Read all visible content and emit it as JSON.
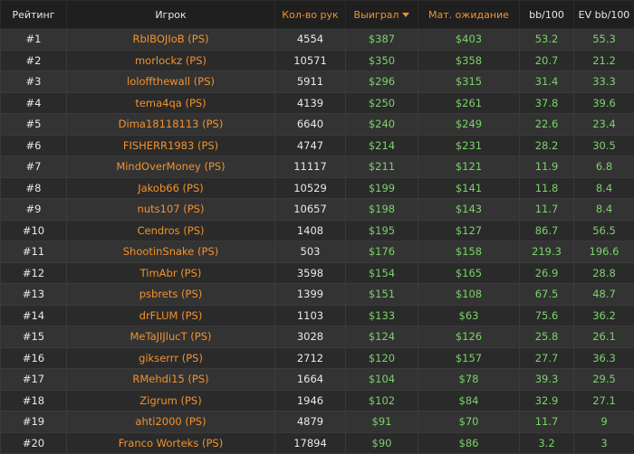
{
  "columns": {
    "rank": "Рейтинг",
    "player": "Игрок",
    "hands": "Кол-во рук",
    "won": "Выиграл",
    "expected": "Мат. ожидание",
    "bb100": "bb/100",
    "evbb100": "EV bb/100"
  },
  "sort_indicator_icon": "caret-down-icon",
  "colors": {
    "orange": "#f0922f",
    "green": "#7ad36a"
  },
  "rows": [
    {
      "rank": "#1",
      "player": "RbIBOJIoB (PS)",
      "hands": "4554",
      "won": "$387",
      "expected": "$403",
      "bb100": "53.2",
      "evbb100": "55.3"
    },
    {
      "rank": "#2",
      "player": "morlockz (PS)",
      "hands": "10571",
      "won": "$350",
      "expected": "$358",
      "bb100": "20.7",
      "evbb100": "21.2"
    },
    {
      "rank": "#3",
      "player": "loloffthewall (PS)",
      "hands": "5911",
      "won": "$296",
      "expected": "$315",
      "bb100": "31.4",
      "evbb100": "33.3"
    },
    {
      "rank": "#4",
      "player": "tema4qa (PS)",
      "hands": "4139",
      "won": "$250",
      "expected": "$261",
      "bb100": "37.8",
      "evbb100": "39.6"
    },
    {
      "rank": "#5",
      "player": "Dima18118113 (PS)",
      "hands": "6640",
      "won": "$240",
      "expected": "$249",
      "bb100": "22.6",
      "evbb100": "23.4"
    },
    {
      "rank": "#6",
      "player": "FISHERR1983 (PS)",
      "hands": "4747",
      "won": "$214",
      "expected": "$231",
      "bb100": "28.2",
      "evbb100": "30.5"
    },
    {
      "rank": "#7",
      "player": "MindOverMoney (PS)",
      "hands": "11117",
      "won": "$211",
      "expected": "$121",
      "bb100": "11.9",
      "evbb100": "6.8"
    },
    {
      "rank": "#8",
      "player": "Jakob66 (PS)",
      "hands": "10529",
      "won": "$199",
      "expected": "$141",
      "bb100": "11.8",
      "evbb100": "8.4"
    },
    {
      "rank": "#9",
      "player": "nuts107 (PS)",
      "hands": "10657",
      "won": "$198",
      "expected": "$143",
      "bb100": "11.7",
      "evbb100": "8.4"
    },
    {
      "rank": "#10",
      "player": "Cendros (PS)",
      "hands": "1408",
      "won": "$195",
      "expected": "$127",
      "bb100": "86.7",
      "evbb100": "56.5"
    },
    {
      "rank": "#11",
      "player": "ShootinSnake (PS)",
      "hands": "503",
      "won": "$176",
      "expected": "$158",
      "bb100": "219.3",
      "evbb100": "196.6"
    },
    {
      "rank": "#12",
      "player": "TimAbr (PS)",
      "hands": "3598",
      "won": "$154",
      "expected": "$165",
      "bb100": "26.9",
      "evbb100": "28.8"
    },
    {
      "rank": "#13",
      "player": "psbrets (PS)",
      "hands": "1399",
      "won": "$151",
      "expected": "$108",
      "bb100": "67.5",
      "evbb100": "48.7"
    },
    {
      "rank": "#14",
      "player": "drFLUM (PS)",
      "hands": "1103",
      "won": "$133",
      "expected": "$63",
      "bb100": "75.6",
      "evbb100": "36.2"
    },
    {
      "rank": "#15",
      "player": "MeTaJIJlucT (PS)",
      "hands": "3028",
      "won": "$124",
      "expected": "$126",
      "bb100": "25.8",
      "evbb100": "26.1"
    },
    {
      "rank": "#16",
      "player": "gikserrr (PS)",
      "hands": "2712",
      "won": "$120",
      "expected": "$157",
      "bb100": "27.7",
      "evbb100": "36.3"
    },
    {
      "rank": "#17",
      "player": "RMehdi15 (PS)",
      "hands": "1664",
      "won": "$104",
      "expected": "$78",
      "bb100": "39.3",
      "evbb100": "29.5"
    },
    {
      "rank": "#18",
      "player": "Zigrum (PS)",
      "hands": "1946",
      "won": "$102",
      "expected": "$84",
      "bb100": "32.9",
      "evbb100": "27.1"
    },
    {
      "rank": "#19",
      "player": "ahti2000 (PS)",
      "hands": "4879",
      "won": "$91",
      "expected": "$70",
      "bb100": "11.7",
      "evbb100": "9"
    },
    {
      "rank": "#20",
      "player": "Franco Worteks (PS)",
      "hands": "17894",
      "won": "$90",
      "expected": "$86",
      "bb100": "3.2",
      "evbb100": "3"
    }
  ]
}
